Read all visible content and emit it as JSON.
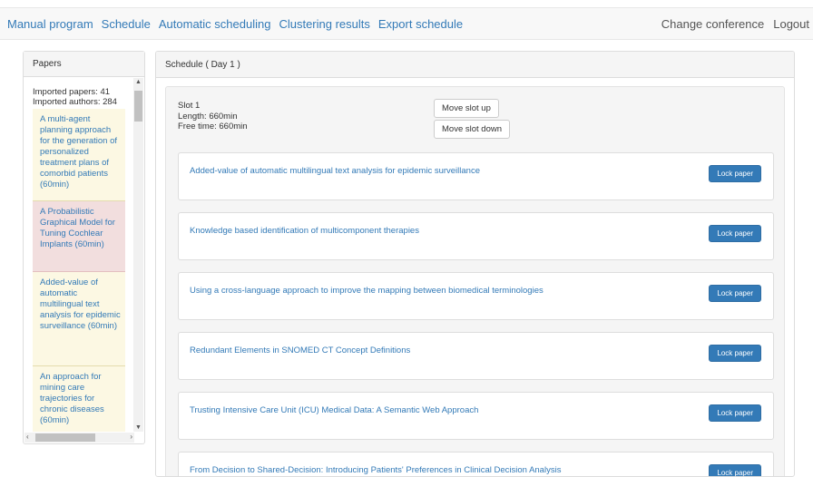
{
  "nav": {
    "left": [
      "Manual program",
      "Schedule",
      "Automatic scheduling",
      "Clustering results",
      "Export schedule"
    ],
    "change_conference": "Change conference",
    "logout": "Logout"
  },
  "papers_panel": {
    "title": "Papers",
    "imported_papers": "Imported papers: 41",
    "imported_authors": "Imported authors: 284",
    "cards": [
      {
        "text": "A multi-agent planning approach for the generation of personalized treatment plans of comorbid patients (60min)",
        "state": "yellow"
      },
      {
        "text": "A Probabilistic Graphical Model for Tuning Cochlear Implants (60min)",
        "state": "red"
      },
      {
        "text": "Added-value of automatic multilingual text analysis for epidemic surveillance (60min)",
        "state": "yellow"
      },
      {
        "text": "An approach for mining care trajectories for chronic diseases (60min)",
        "state": "yellow"
      }
    ]
  },
  "schedule": {
    "title": "Schedule ( Day 1 )",
    "slot": {
      "name": "Slot 1",
      "length": "Length: 660min",
      "free_time": "Free time: 660min",
      "move_up": "Move slot up",
      "move_down": "Move slot down"
    },
    "lock_label": "Lock paper",
    "papers": [
      "Added-value of automatic multilingual text analysis for epidemic surveillance",
      "Knowledge based identification of multicomponent therapies",
      "Using a cross-language approach to improve the mapping between biomedical terminologies",
      "Redundant Elements in SNOMED CT Concept Definitions",
      "Trusting Intensive Care Unit (ICU) Medical Data: A Semantic Web Approach",
      "From Decision to Shared-Decision: Introducing Patients' Preferences in Clinical Decision Analysis"
    ]
  }
}
